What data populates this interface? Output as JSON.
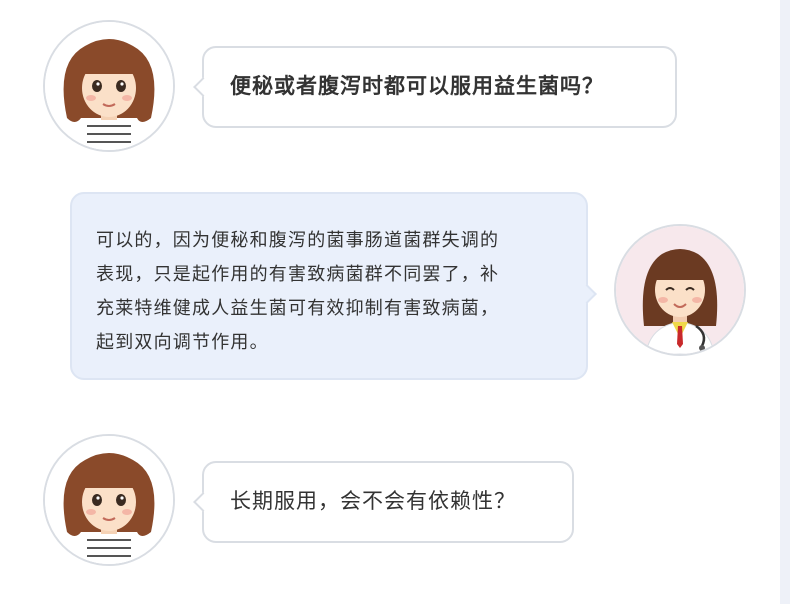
{
  "conversation": {
    "q1": "便秘或者腹泻时都可以服用益生菌吗？",
    "answer_lines": [
      "可以的，因为便秘和腹泻的菌事肠道菌群失调的",
      "表现，只是起作用的有害致病菌群不同罢了，补",
      "充莱特维健成人益生菌可有效抑制有害致病菌，",
      "起到双向调节作用。"
    ],
    "q2": "长期服用，会不会有依赖性？"
  },
  "colors": {
    "user_bubble_bg": "#ffffff",
    "doctor_bubble_bg": "#eaf0fb",
    "hair": "#8a4a2a",
    "text": "#333333"
  },
  "icons": [
    "girl-avatar",
    "doctor-avatar"
  ]
}
